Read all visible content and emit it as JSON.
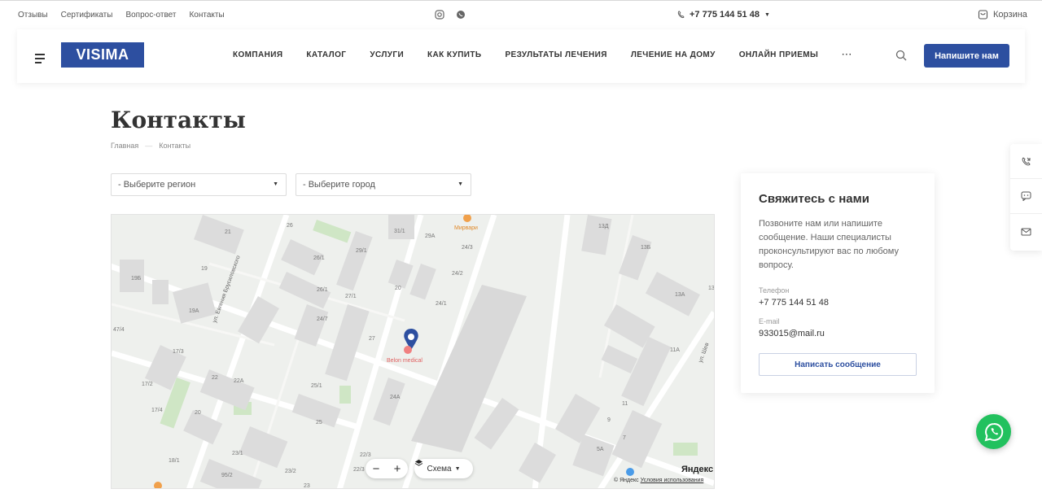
{
  "topbar": {
    "links": [
      "Отзывы",
      "Сертификаты",
      "Вопрос-ответ",
      "Контакты"
    ],
    "social_icons": [
      "instagram-icon",
      "whatsapp-icon"
    ],
    "phone": "+7 775 144 51 48",
    "cart_label": "Корзина"
  },
  "header": {
    "logo": "VISIMA",
    "nav": [
      "КОМПАНИЯ",
      "КАТАЛОГ",
      "УСЛУГИ",
      "КАК КУПИТЬ",
      "РЕЗУЛЬТАТЫ ЛЕЧЕНИЯ",
      "ЛЕЧЕНИЕ НА ДОМУ",
      "ОНЛАЙН ПРИЕМЫ",
      "···"
    ],
    "write_button": "Напишите нам"
  },
  "page": {
    "title": "Контакты",
    "breadcrumb": [
      "Главная",
      "—",
      "Контакты"
    ]
  },
  "filters": {
    "region": "- Выберите регион",
    "city": "- Выберите город"
  },
  "map": {
    "marker_label": "Belon medical",
    "poi_label": "Мирвари",
    "street_label_1": "ул. Евгения Брусиловского",
    "street_label_2": "ул. Шев",
    "building_numbers": [
      "21",
      "26",
      "31/1",
      "29A",
      "24/3",
      "13Д",
      "13Б",
      "19",
      "19Б",
      "26/1",
      "29/1",
      "24/2",
      "20",
      "13A",
      "13",
      "19A",
      "24/1",
      "26/1",
      "27/1",
      "24/7",
      "47/4",
      "27",
      "11A",
      "17/3",
      "22",
      "22A",
      "25/1",
      "17/2",
      "24A",
      "11",
      "17/4",
      "20",
      "9",
      "25",
      "7",
      "5A",
      "22/3",
      "23/1",
      "18/1",
      "95/2",
      "23/2",
      "23",
      "22/3"
    ],
    "zoom_out": "−",
    "zoom_in": "+",
    "scheme_label": "Схема",
    "yandex_logo": "Яндекс",
    "copyright": "© Яндекс",
    "terms": "Условия использования"
  },
  "contact_card": {
    "title": "Свяжитесь с нами",
    "description": "Позвоните нам или напишите сообщение. Наши специалисты проконсультируют вас по любому вопросу.",
    "phone_label": "Телефон",
    "phone": "+7 775 144 51 48",
    "email_label": "E-mail",
    "email": "933015@mail.ru",
    "button": "Написать сообщение"
  },
  "side_widget": [
    "phone-callback-icon",
    "chat-icon",
    "mail-icon"
  ],
  "colors": {
    "brand": "#2d4fa0",
    "whatsapp": "#22c15e"
  }
}
